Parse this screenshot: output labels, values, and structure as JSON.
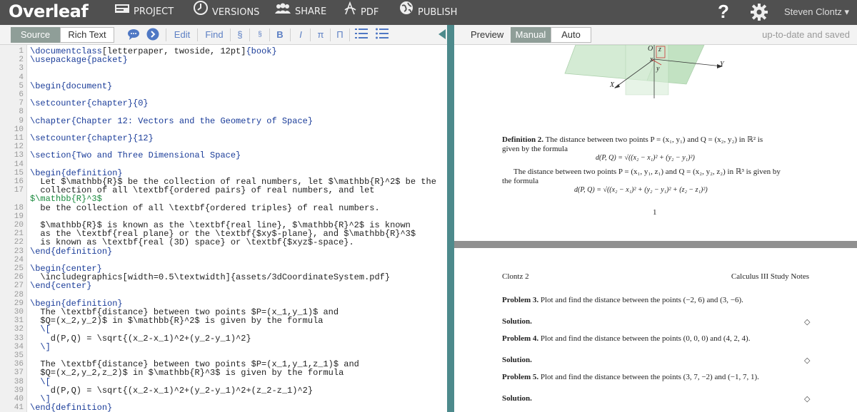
{
  "topbar": {
    "logo": "Overleaf",
    "project": "PROJECT",
    "versions": "VERSIONS",
    "share": "SHARE",
    "pdf": "PDF",
    "publish": "PUBLISH",
    "help": "?",
    "user": "Steven Clontz ▾"
  },
  "editor_toolbar": {
    "source": "Source",
    "rich_text": "Rich Text",
    "edit": "Edit",
    "find": "Find",
    "section": "§",
    "subsection": "§",
    "bold": "B",
    "italic": "I",
    "pi": "π",
    "pi2": "Π"
  },
  "preview_toolbar": {
    "label": "Preview",
    "manual": "Manual",
    "auto": "Auto",
    "status": "up-to-date and saved"
  },
  "line_numbers": [
    "1",
    "2",
    "3",
    "4",
    "5",
    "6",
    "7",
    "8",
    "9",
    "10",
    "11",
    "12",
    "13",
    "14",
    "15",
    "16",
    "17",
    "",
    "18",
    "19",
    "20",
    "21",
    "22",
    "23",
    "24",
    "25",
    "26",
    "27",
    "28",
    "29",
    "30",
    "31",
    "32",
    "33",
    "34",
    "35",
    "36",
    "37",
    "38",
    "39",
    "40",
    "41"
  ],
  "code": {
    "l1a": "\\documentclass",
    "l1b": "[letterpaper, twoside, 12pt]",
    "l1c": "{book}",
    "l2a": "\\usepackage",
    "l2b": "{packet}",
    "l5a": "\\begin",
    "l5b": "{document}",
    "l7a": "\\setcounter",
    "l7b": "{chapter}{0}",
    "l9a": "\\chapter",
    "l9b": "{Chapter 12: Vectors and the Geometry of Space}",
    "l11a": "\\setcounter",
    "l11b": "{chapter}{12}",
    "l13a": "\\section",
    "l13b": "{Two and Three Dimensional Space}",
    "l15a": "\\begin",
    "l15b": "{definition}",
    "l16": "  Let $\\mathbb{R}$ be the collection of real numbers, let $\\mathbb{R}^2$ be the",
    "l17": "  collection of all \\textbf{ordered pairs} of real numbers, and let",
    "l17b": "$\\mathbb{R}^3$",
    "l18": "  be the collection of all \\textbf{ordered triples} of real numbers.",
    "l20": "  $\\mathbb{R}$ is known as the \\textbf{real line}, $\\mathbb{R}^2$ is known",
    "l21": "  as the \\textbf{real plane} or the \\textbf{$xy$-plane}, and $\\mathbb{R}^3$",
    "l22": "  is known as \\textbf{real (3D) space} or \\textbf{$xyz$-space}.",
    "l23a": "\\end",
    "l23b": "{definition}",
    "l25a": "\\begin",
    "l25b": "{center}",
    "l26": "  \\includegraphics[width=0.5\\textwidth]{assets/3dCoordinateSystem.pdf}",
    "l27a": "\\end",
    "l27b": "{center}",
    "l29a": "\\begin",
    "l29b": "{definition}",
    "l30": "  The \\textbf{distance} between two points $P=(x_1,y_1)$ and",
    "l31": "  $Q=(x_2,y_2)$ in $\\mathbb{R}^2$ is given by the formula",
    "l32": "  \\[",
    "l33": "    d(P,Q) = \\sqrt{(x_2-x_1)^2+(y_2-y_1)^2}",
    "l34": "  \\]",
    "l36": "  The \\textbf{distance} between two points $P=(x_1,y_1,z_1)$ and",
    "l37": "  $Q=(x_2,y_2,z_2)$ in $\\mathbb{R}^3$ is given by the formula",
    "l38": "  \\[",
    "l39": "    d(P,Q) = \\sqrt{(x_2-x_1)^2+(y_2-y_1)^2+(z_2-z_1)^2}",
    "l40": "  \\]",
    "l41a": "\\end",
    "l41b": "{definition}"
  },
  "pdf": {
    "fig_o": "O",
    "fig_z": "z",
    "fig_x": "x",
    "fig_y": "y",
    "fig_X": "X",
    "fig_Y": "Y",
    "def2_bold": "Definition 2.",
    "def2_text1": "The distance between two points P = (x₁, y₁) and Q = (x₂, y₂) in ℝ² is",
    "def2_text2": "given by the formula",
    "eq1": "d(P, Q) = √((x₂ − x₁)² + (y₂ − y₁)²)",
    "def2_text3": "The distance between two points P = (x₁, y₁, z₁) and Q = (x₂, y₂, z₂) in ℝ³ is given by",
    "def2_text4": "the formula",
    "eq2": "d(P, Q) = √((x₂ − x₁)² + (y₂ − y₁)² + (z₂ − z₁)²)",
    "page_num": "1",
    "header_left": "Clontz 2",
    "header_right": "Calculus III Study Notes",
    "p3_bold": "Problem 3.",
    "p3_text": "Plot and find the distance between the points (−2, 6) and (3, −6).",
    "sol_label": "Solution.",
    "p4_bold": "Problem 4.",
    "p4_text": "Plot and find the distance between the points (0, 0, 0) and (4, 2, 4).",
    "p5_bold": "Problem 5.",
    "p5_text": "Plot and find the distance between the points (3, 7, −2) and (−1, 7, 1).",
    "qed": "◇"
  },
  "colors": {
    "topbar": "#505050",
    "accent": "#8f9e98",
    "splitter": "#4d8a8c"
  }
}
